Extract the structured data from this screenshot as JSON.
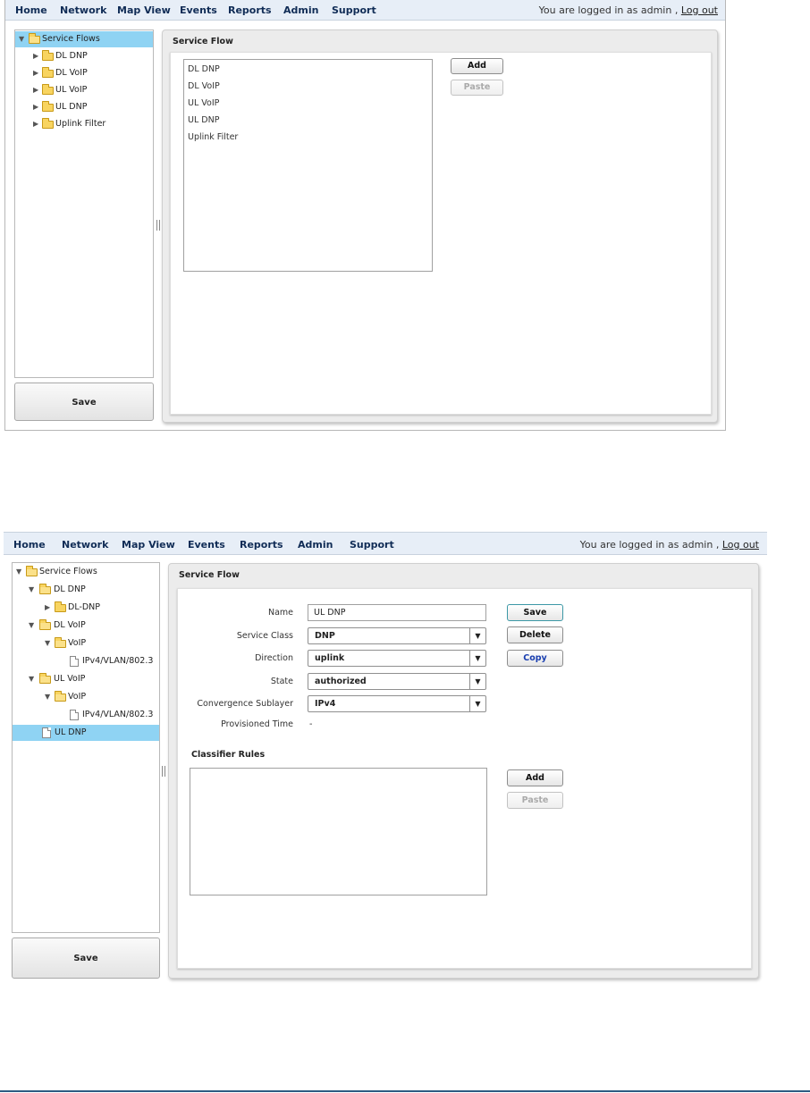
{
  "nav": {
    "items": [
      "Home",
      "Network",
      "Map View",
      "Events",
      "Reports",
      "Admin",
      "Support"
    ],
    "login_prefix": "You are logged in as admin , ",
    "logout": "Log out"
  },
  "screen1": {
    "tree": [
      {
        "label": "Service Flows",
        "selected": true,
        "expanded": true
      },
      {
        "label": "DL DNP"
      },
      {
        "label": "DL VoIP"
      },
      {
        "label": "UL VoIP"
      },
      {
        "label": "UL DNP"
      },
      {
        "label": "Uplink Filter"
      }
    ],
    "save_label": "Save",
    "panel_title": "Service Flow",
    "list_items": [
      "DL DNP",
      "DL VoIP",
      "UL VoIP",
      "UL DNP",
      "Uplink Filter"
    ],
    "add_label": "Add",
    "paste_label": "Paste"
  },
  "screen2": {
    "tree": [
      {
        "label": "Service Flows"
      },
      {
        "label": "DL DNP"
      },
      {
        "label": "DL-DNP"
      },
      {
        "label": "DL VoIP"
      },
      {
        "label": "VoIP"
      },
      {
        "label": "IPv4/VLAN/802.3"
      },
      {
        "label": "UL VoIP"
      },
      {
        "label": "VoIP"
      },
      {
        "label": "IPv4/VLAN/802.3"
      },
      {
        "label": "UL DNP",
        "selected": true
      }
    ],
    "save_label": "Save",
    "panel_title": "Service Flow",
    "form": {
      "name_label": "Name",
      "name_value": "UL DNP",
      "service_class_label": "Service Class",
      "service_class_value": "DNP",
      "direction_label": "Direction",
      "direction_value": "uplink",
      "state_label": "State",
      "state_value": "authorized",
      "conv_label": "Convergence Sublayer",
      "conv_value": "IPv4",
      "prov_label": "Provisioned Time",
      "prov_value": "-"
    },
    "buttons": {
      "save": "Save",
      "delete": "Delete",
      "copy": "Copy",
      "add": "Add",
      "paste": "Paste"
    },
    "classifier_title": "Classifier Rules"
  },
  "colors": {
    "nav_bg": "#e7eef7",
    "nav_text": "#102c56",
    "selection": "#8fd3f3",
    "folder": "#f8d460",
    "footer_rule": "#2d5b82"
  }
}
